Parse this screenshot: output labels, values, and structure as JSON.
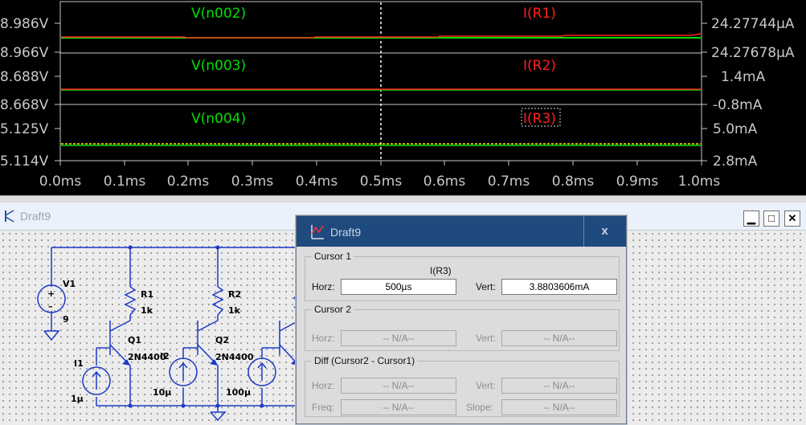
{
  "waveform": {
    "panes": [
      {
        "left_label": "V(n002)",
        "right_label": "I(R1)",
        "left_top": "8.986V",
        "left_bottom": "8.966V",
        "right_top": "24.27744µA",
        "right_bottom": "24.27678µA"
      },
      {
        "left_label": "V(n003)",
        "right_label": "I(R2)",
        "left_top": "8.688V",
        "left_bottom": "8.668V",
        "right_top": "1.4mA",
        "right_bottom": "-0.8mA"
      },
      {
        "left_label": "V(n004)",
        "right_label": "I(R3)",
        "left_top": "5.125V",
        "left_bottom": "5.114V",
        "right_top": "5.0mA",
        "right_bottom": "2.8mA"
      }
    ],
    "x_ticks": [
      "0.0ms",
      "0.1ms",
      "0.2ms",
      "0.3ms",
      "0.4ms",
      "0.5ms",
      "0.6ms",
      "0.7ms",
      "0.8ms",
      "0.9ms",
      "1.0ms"
    ],
    "colors": {
      "voltage": "#00e000",
      "current": "#ff2020",
      "cursor": "#ffffff"
    }
  },
  "schematic": {
    "title": "Draft9",
    "buttons": {
      "minimize": "▁",
      "maximize": "□",
      "close": "✕"
    },
    "components": {
      "v1_name": "V1",
      "v1_value": "9",
      "r1_name": "R1",
      "r1_value": "1k",
      "r2_name": "R2",
      "r2_value": "1k",
      "q1_name": "Q1",
      "q1_model": "2N4400",
      "q2_name": "Q2",
      "q2_model": "2N4400",
      "i1_name": "I1",
      "i1_value": "1µ",
      "i2_name": "I2",
      "i2_value": "10µ",
      "i3_value": "100µ"
    }
  },
  "cursor_dialog": {
    "title": "Draft9",
    "close": "x",
    "cursor1": {
      "legend": "Cursor 1",
      "trace": "I(R3)",
      "horz_label": "Horz:",
      "horz_value": "500µs",
      "vert_label": "Vert:",
      "vert_value": "3.8803606mA"
    },
    "cursor2": {
      "legend": "Cursor 2",
      "horz_label": "Horz:",
      "horz_value": "-- N/A--",
      "vert_label": "Vert:",
      "vert_value": "-- N/A--"
    },
    "diff": {
      "legend": "Diff (Cursor2 - Cursor1)",
      "horz_label": "Horz:",
      "horz_value": "-- N/A--",
      "vert_label": "Vert:",
      "vert_value": "-- N/A--",
      "freq_label": "Freq:",
      "freq_value": "-- N/A--",
      "slope_label": "Slope:",
      "slope_value": "-- N/A--"
    }
  }
}
